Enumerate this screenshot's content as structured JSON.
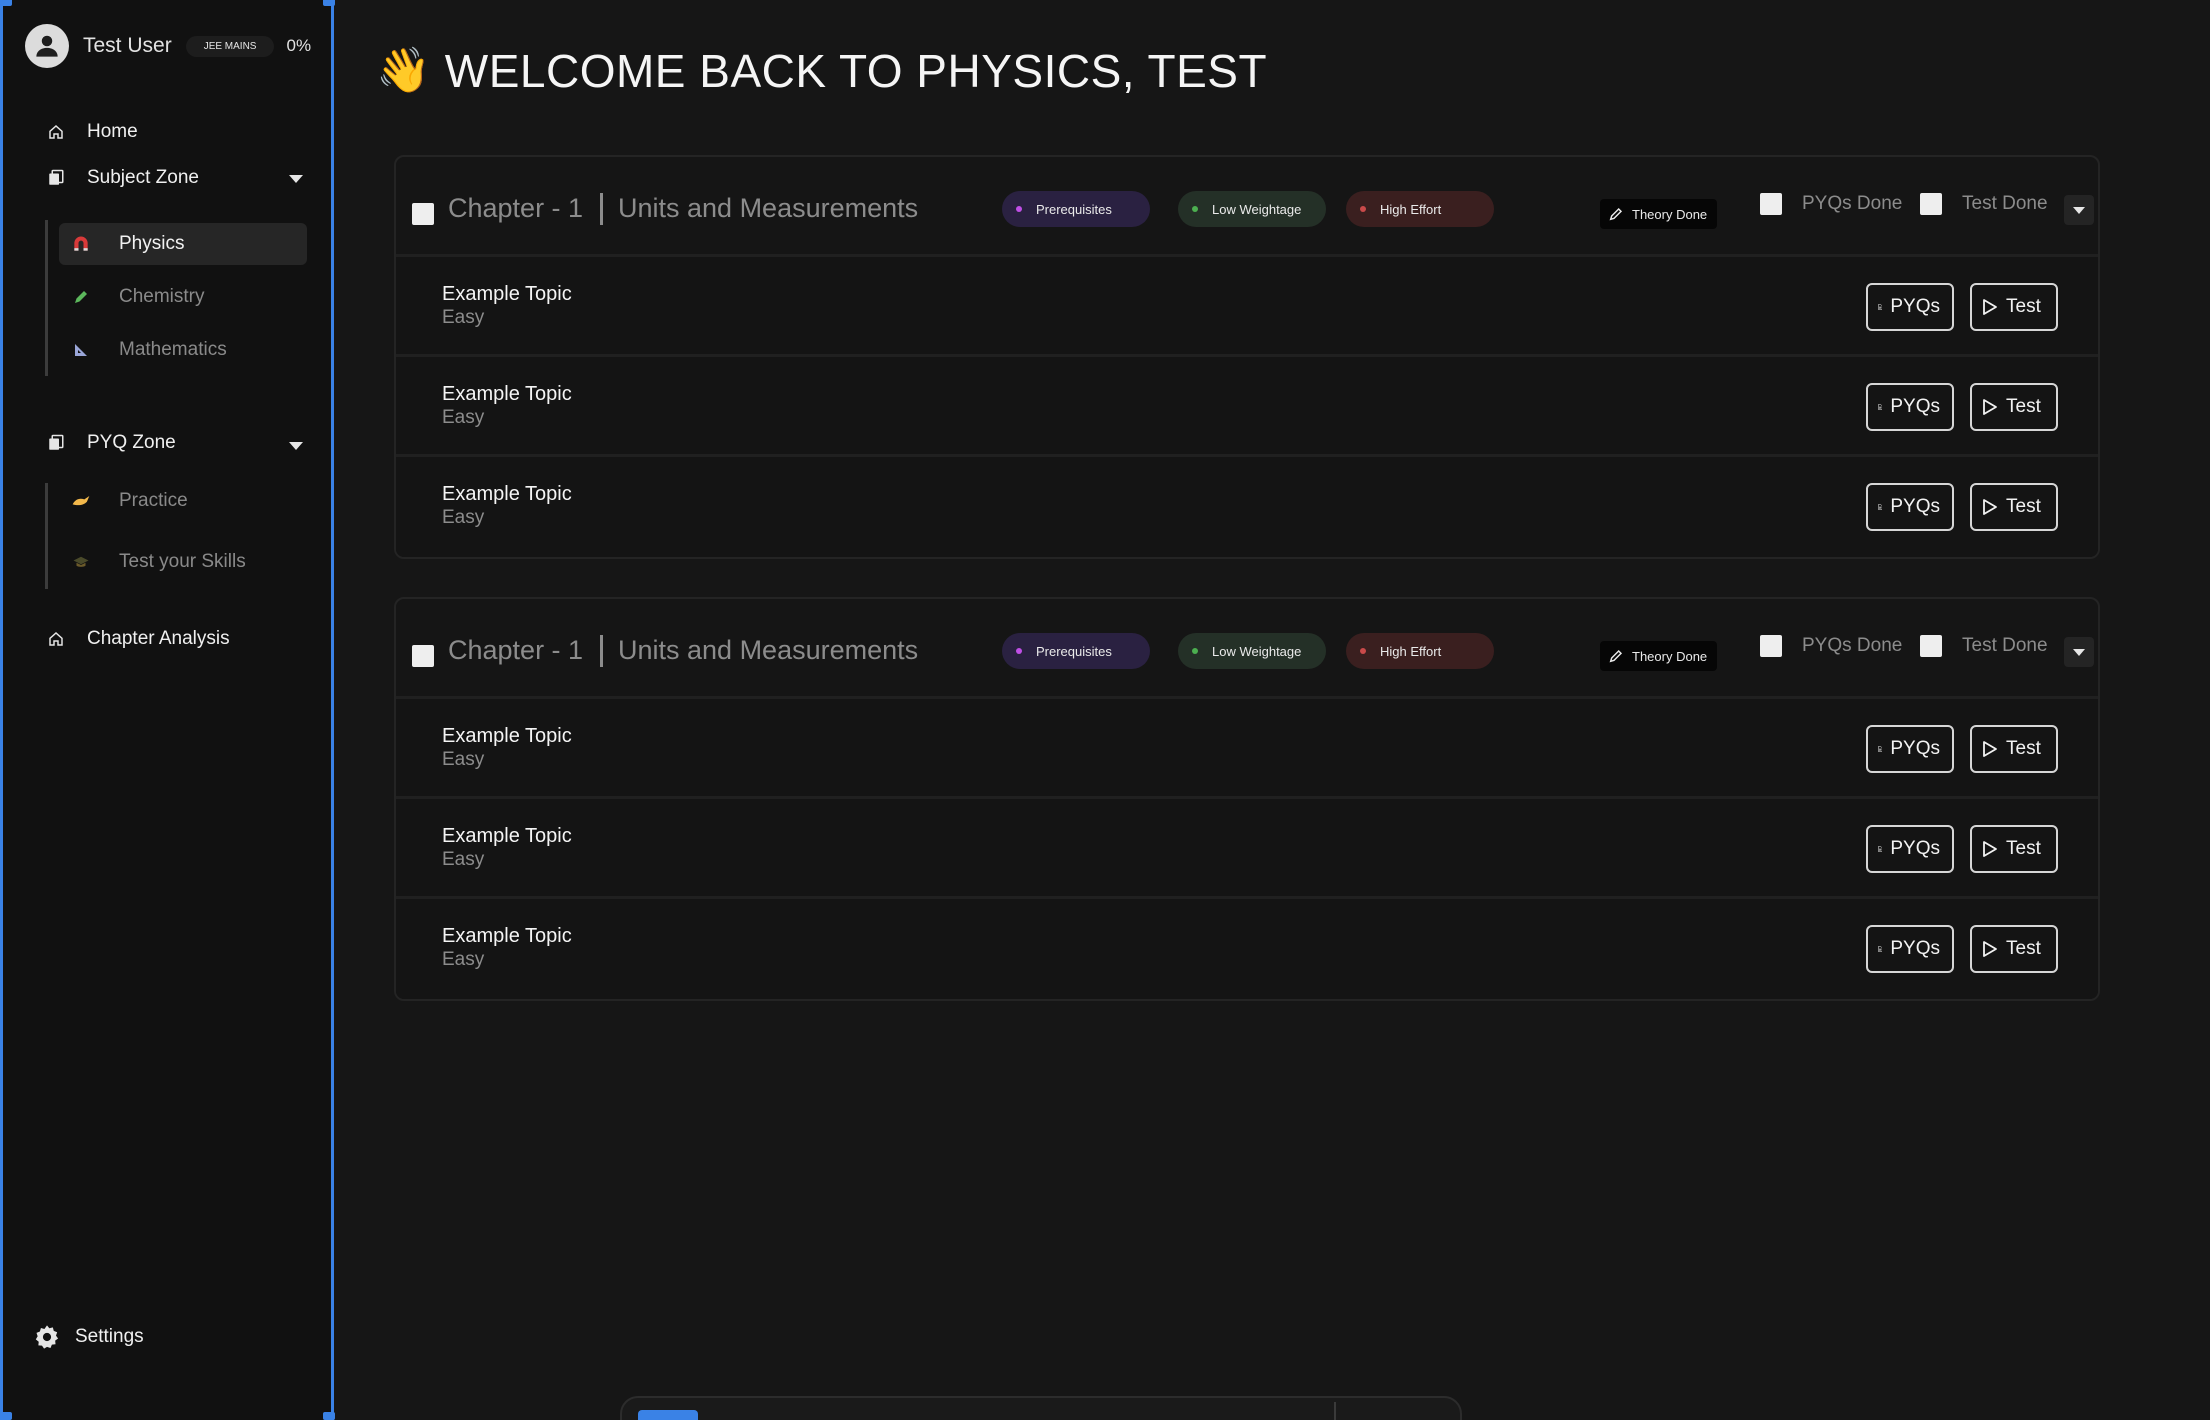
{
  "user": {
    "name": "Test User",
    "exam": "JEE MAINS",
    "progress": "0%"
  },
  "nav": {
    "home": "Home",
    "subject_zone": "Subject Zone",
    "subjects": [
      {
        "label": "Physics",
        "icon": "magnet-icon",
        "active": true
      },
      {
        "label": "Chemistry",
        "icon": "pencil-icon",
        "active": false
      },
      {
        "label": "Mathematics",
        "icon": "set-square-icon",
        "active": false
      }
    ],
    "pyq_zone": "PYQ Zone",
    "pyq_items": [
      {
        "label": "Practice",
        "icon": "writing-hand-icon"
      },
      {
        "label": "Test your Skills",
        "icon": "graduation-cap-icon"
      }
    ],
    "chapter_analysis": "Chapter Analysis",
    "settings": "Settings"
  },
  "header": {
    "emoji": "👋",
    "title": "WELCOME BACK TO PHYSICS, TEST"
  },
  "chapters": [
    {
      "number": "Chapter - 1",
      "name": "Units and Measurements",
      "tags": {
        "prerequisites": "Prerequisites",
        "weightage": "Low Weightage",
        "effort": "High Effort"
      },
      "theory_done": "Theory Done",
      "pyqs_done": "PYQs Done",
      "test_done": "Test Done",
      "topics": [
        {
          "title": "Example Topic",
          "level": "Easy"
        },
        {
          "title": "Example Topic",
          "level": "Easy"
        },
        {
          "title": "Example Topic",
          "level": "Easy"
        }
      ]
    },
    {
      "number": "Chapter - 1",
      "name": "Units and Measurements",
      "tags": {
        "prerequisites": "Prerequisites",
        "weightage": "Low Weightage",
        "effort": "High Effort"
      },
      "theory_done": "Theory Done",
      "pyqs_done": "PYQs Done",
      "test_done": "Test Done",
      "topics": [
        {
          "title": "Example Topic",
          "level": "Easy"
        },
        {
          "title": "Example Topic",
          "level": "Easy"
        },
        {
          "title": "Example Topic",
          "level": "Easy"
        }
      ]
    }
  ],
  "buttons": {
    "pyqs": "PYQs",
    "test": "Test"
  },
  "colors": {
    "accent": "#3a82e6",
    "prerequisites_dot": "#c04fe6",
    "weightage_dot": "#4caf50",
    "effort_dot": "#c94a4a"
  }
}
